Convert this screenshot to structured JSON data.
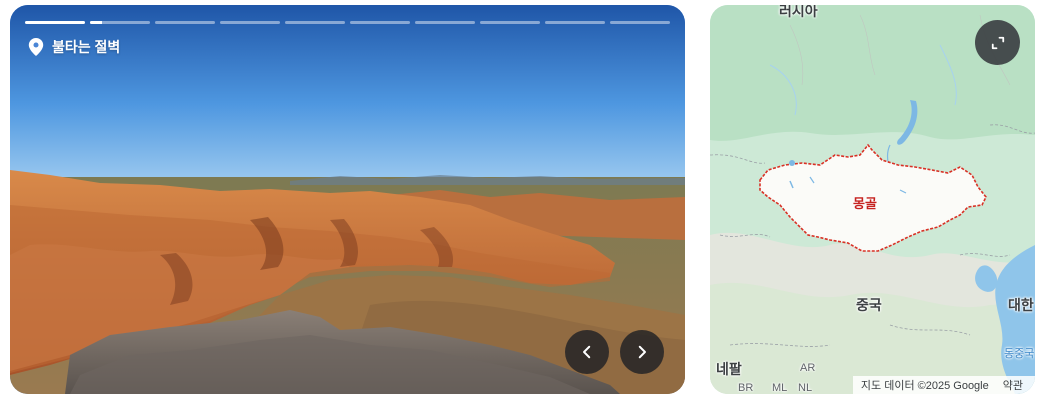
{
  "photo": {
    "location_name": "불타는 절벽",
    "progress": {
      "segments": 10,
      "active_index": 1,
      "fill": [
        1,
        0.2,
        0,
        0,
        0,
        0,
        0,
        0,
        0,
        0
      ]
    },
    "prev_icon": "chevron-left-icon",
    "next_icon": "chevron-right-icon"
  },
  "map": {
    "labels": {
      "russia": "러시아",
      "mongolia": "몽골",
      "china": "중국",
      "korea": "대한",
      "nepal": "네팔",
      "east_sea": "동중국",
      "ar": "AR",
      "br": "BR",
      "ml": "ML",
      "nl": "NL"
    },
    "expand_icon": "expand-icon",
    "attribution": "지도 데이터 ©2025 Google",
    "terms": "약관",
    "colors": {
      "highlight_border": "#d93025",
      "highlight_fill": "#fbfbf8"
    }
  }
}
